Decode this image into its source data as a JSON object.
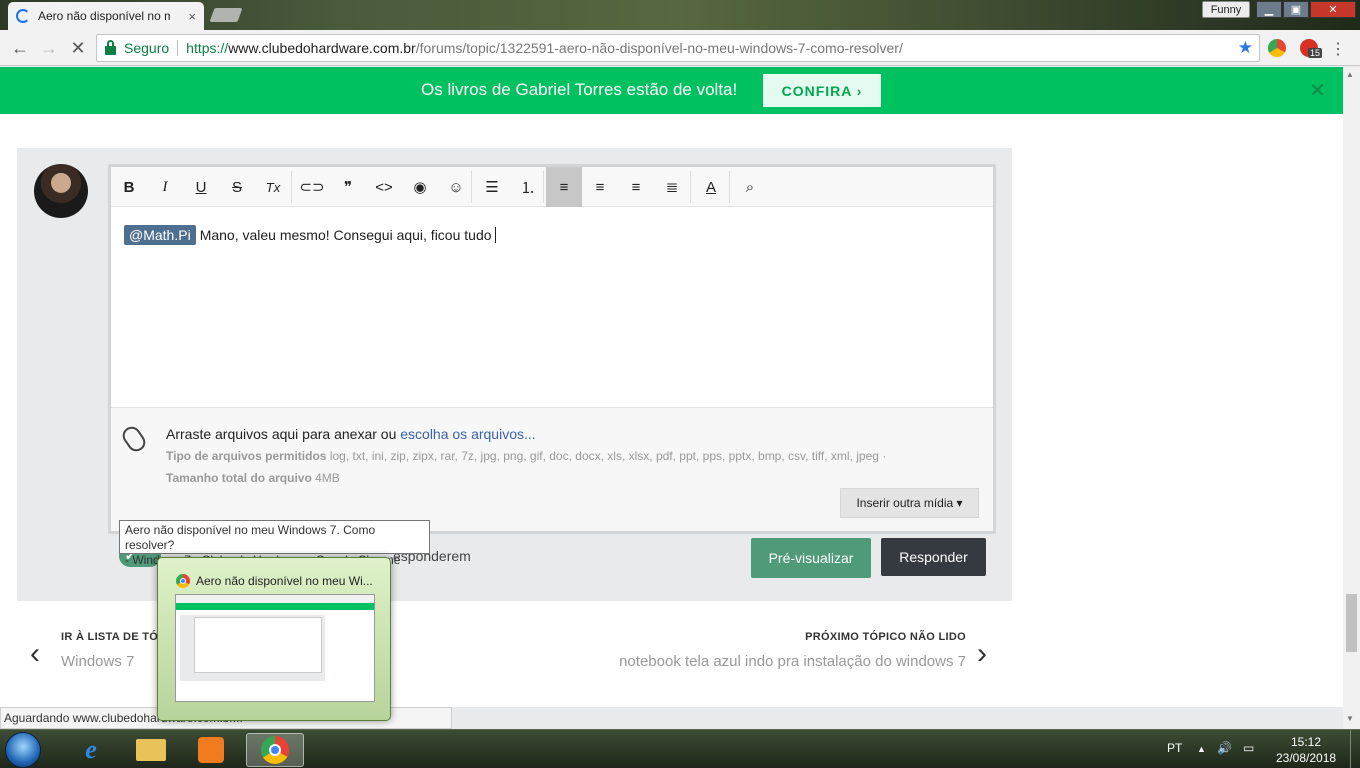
{
  "browser": {
    "tab_title": "Aero não disponível no m",
    "tab_close": "×",
    "profile_name": "Funny",
    "window_min": "▁",
    "window_max": "▣",
    "window_close": "✕",
    "secure_label": "Seguro",
    "url_scheme": "https://",
    "url_host": "www.clubedohardware.com.br",
    "url_path": "/forums/topic/1322591-aero-não-disponível-no-meu-windows-7-como-resolver/",
    "extension_badge": "15"
  },
  "banner": {
    "text": "Os livros de Gabriel Torres estão de volta!",
    "button": "CONFIRA ›",
    "close": "✕"
  },
  "editor": {
    "mention": "@Math.Pi",
    "body_text": "Mano, valeu mesmo! Consegui aqui, ficou tudo ",
    "toolbar": [
      {
        "name": "bold",
        "glyph": "B"
      },
      {
        "name": "italic",
        "glyph": "I"
      },
      {
        "name": "underline",
        "glyph": "U"
      },
      {
        "name": "strikethrough",
        "glyph": "S"
      },
      {
        "name": "remove-format",
        "glyph": "Tx"
      },
      {
        "name": "link",
        "glyph": "⊂⊃"
      },
      {
        "name": "quote",
        "glyph": "❞"
      },
      {
        "name": "code",
        "glyph": "<>"
      },
      {
        "name": "spoiler",
        "glyph": "◉"
      },
      {
        "name": "emoji",
        "glyph": "☺"
      },
      {
        "name": "bullet-list",
        "glyph": "☰"
      },
      {
        "name": "numbered-list",
        "glyph": "⒈"
      },
      {
        "name": "align-left",
        "glyph": "≡"
      },
      {
        "name": "align-right",
        "glyph": "≡"
      },
      {
        "name": "align-center",
        "glyph": "≡"
      },
      {
        "name": "align-justify",
        "glyph": "≣"
      },
      {
        "name": "font-color",
        "glyph": "A"
      },
      {
        "name": "preview",
        "glyph": "⌕"
      }
    ]
  },
  "attachments": {
    "prompt": "Arraste arquivos aqui para anexar ou ",
    "link": "escolha os arquivos...",
    "types_label": "Tipo de arquivos permitidos",
    "types_value": " log, txt, ini, zip, zipx, rar, 7z, jpg, png, gif, doc, docx, xls, xlsx, pdf, ppt, pps, pptx, bmp, csv, tiff, xml, jpeg ·",
    "size_label": "Tamanho total do arquivo",
    "size_value": " 4MB",
    "media_button": "Inserir outra mídia ▾"
  },
  "actions": {
    "notify_text": "esponderem",
    "preview_button": "Pré-visualizar",
    "reply_button": "Responder"
  },
  "navigation": {
    "prev_label": "IR À LISTA DE TÓ",
    "prev_title": "Windows 7",
    "next_label": "PRÓXIMO TÓPICO NÃO LIDO",
    "next_title": "notebook tela azul indo pra instalação do windows 7"
  },
  "status_bar": "Aguardando www.clubedohardware.com.br...",
  "tooltip": {
    "line1": "Aero não disponível no meu Windows 7. Como resolver?",
    "line2": "- Windows 7 - Clube do Hardware - Google Chrome"
  },
  "thumbnail_title": "Aero não disponível no meu Wi...",
  "taskbar": {
    "language": "PT",
    "time": "15:12",
    "date": "23/08/2018"
  }
}
